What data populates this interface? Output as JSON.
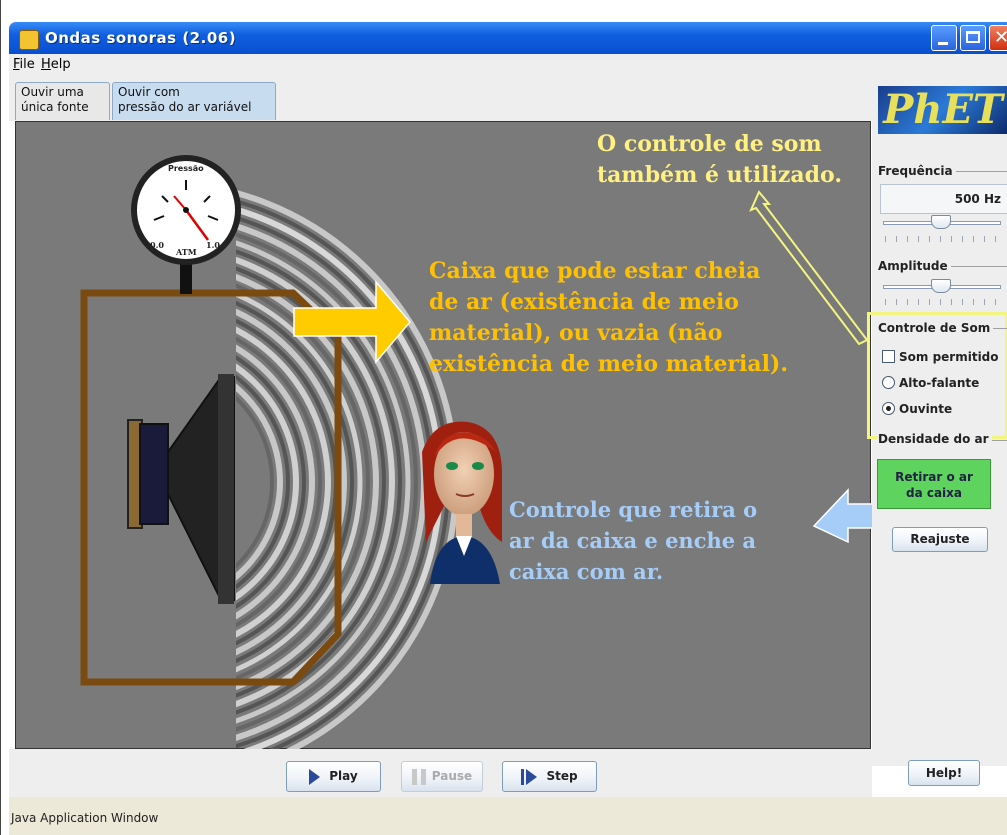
{
  "window": {
    "title": "Ondas sonoras (2.06)"
  },
  "menu": [
    "File",
    "Help"
  ],
  "tabs": [
    {
      "line1": "Ouvir uma",
      "line2": "única fonte"
    },
    {
      "line1": "Ouvir com",
      "line2": "pressão do ar variável"
    }
  ],
  "gauge": {
    "label": "Pressão",
    "min": "0.0",
    "unit": "ATM",
    "max": "1.0"
  },
  "panel": {
    "logo": "PhET",
    "frequency": {
      "label": "Frequência",
      "value": "500 Hz"
    },
    "amplitude": {
      "label": "Amplitude"
    },
    "sound_control": {
      "label": "Controle de Som",
      "sound_allowed": "Som permitido",
      "speaker": "Alto-falante",
      "listener": "Ouvinte",
      "selected": "Ouvinte"
    },
    "air_density": {
      "label": "Densidade do ar",
      "remove_line1": "Retirar o ar",
      "remove_line2": "da caixa",
      "reset": "Reajuste"
    },
    "help": "Help!"
  },
  "playback": {
    "play": "Play",
    "pause": "Pause",
    "step": "Step"
  },
  "status": "Java Application Window",
  "annotations": {
    "sound_control_note": [
      "O controle de som",
      "também é utilizado."
    ],
    "box_note": [
      "Caixa que pode estar cheia",
      "de ar (existência de meio",
      "material), ou vazia (não",
      "existência de meio material)."
    ],
    "air_control_note": [
      "Controle que retira o",
      "ar da caixa e enche a",
      "caixa com ar."
    ]
  },
  "colors": {
    "title_bar": "#0f5fe0",
    "sim_background": "#7a7a7a",
    "box_frame": "#7a4a10",
    "annotation_yellow": "#fff080",
    "annotation_orange": "#ffc000",
    "annotation_blue": "#a6ccf8",
    "air_button": "#5ed35e"
  },
  "icons": [
    "java-app-icon",
    "minimize-icon",
    "maximize-icon",
    "close-icon",
    "play-icon",
    "pause-icon",
    "step-icon",
    "phet-logo"
  ]
}
